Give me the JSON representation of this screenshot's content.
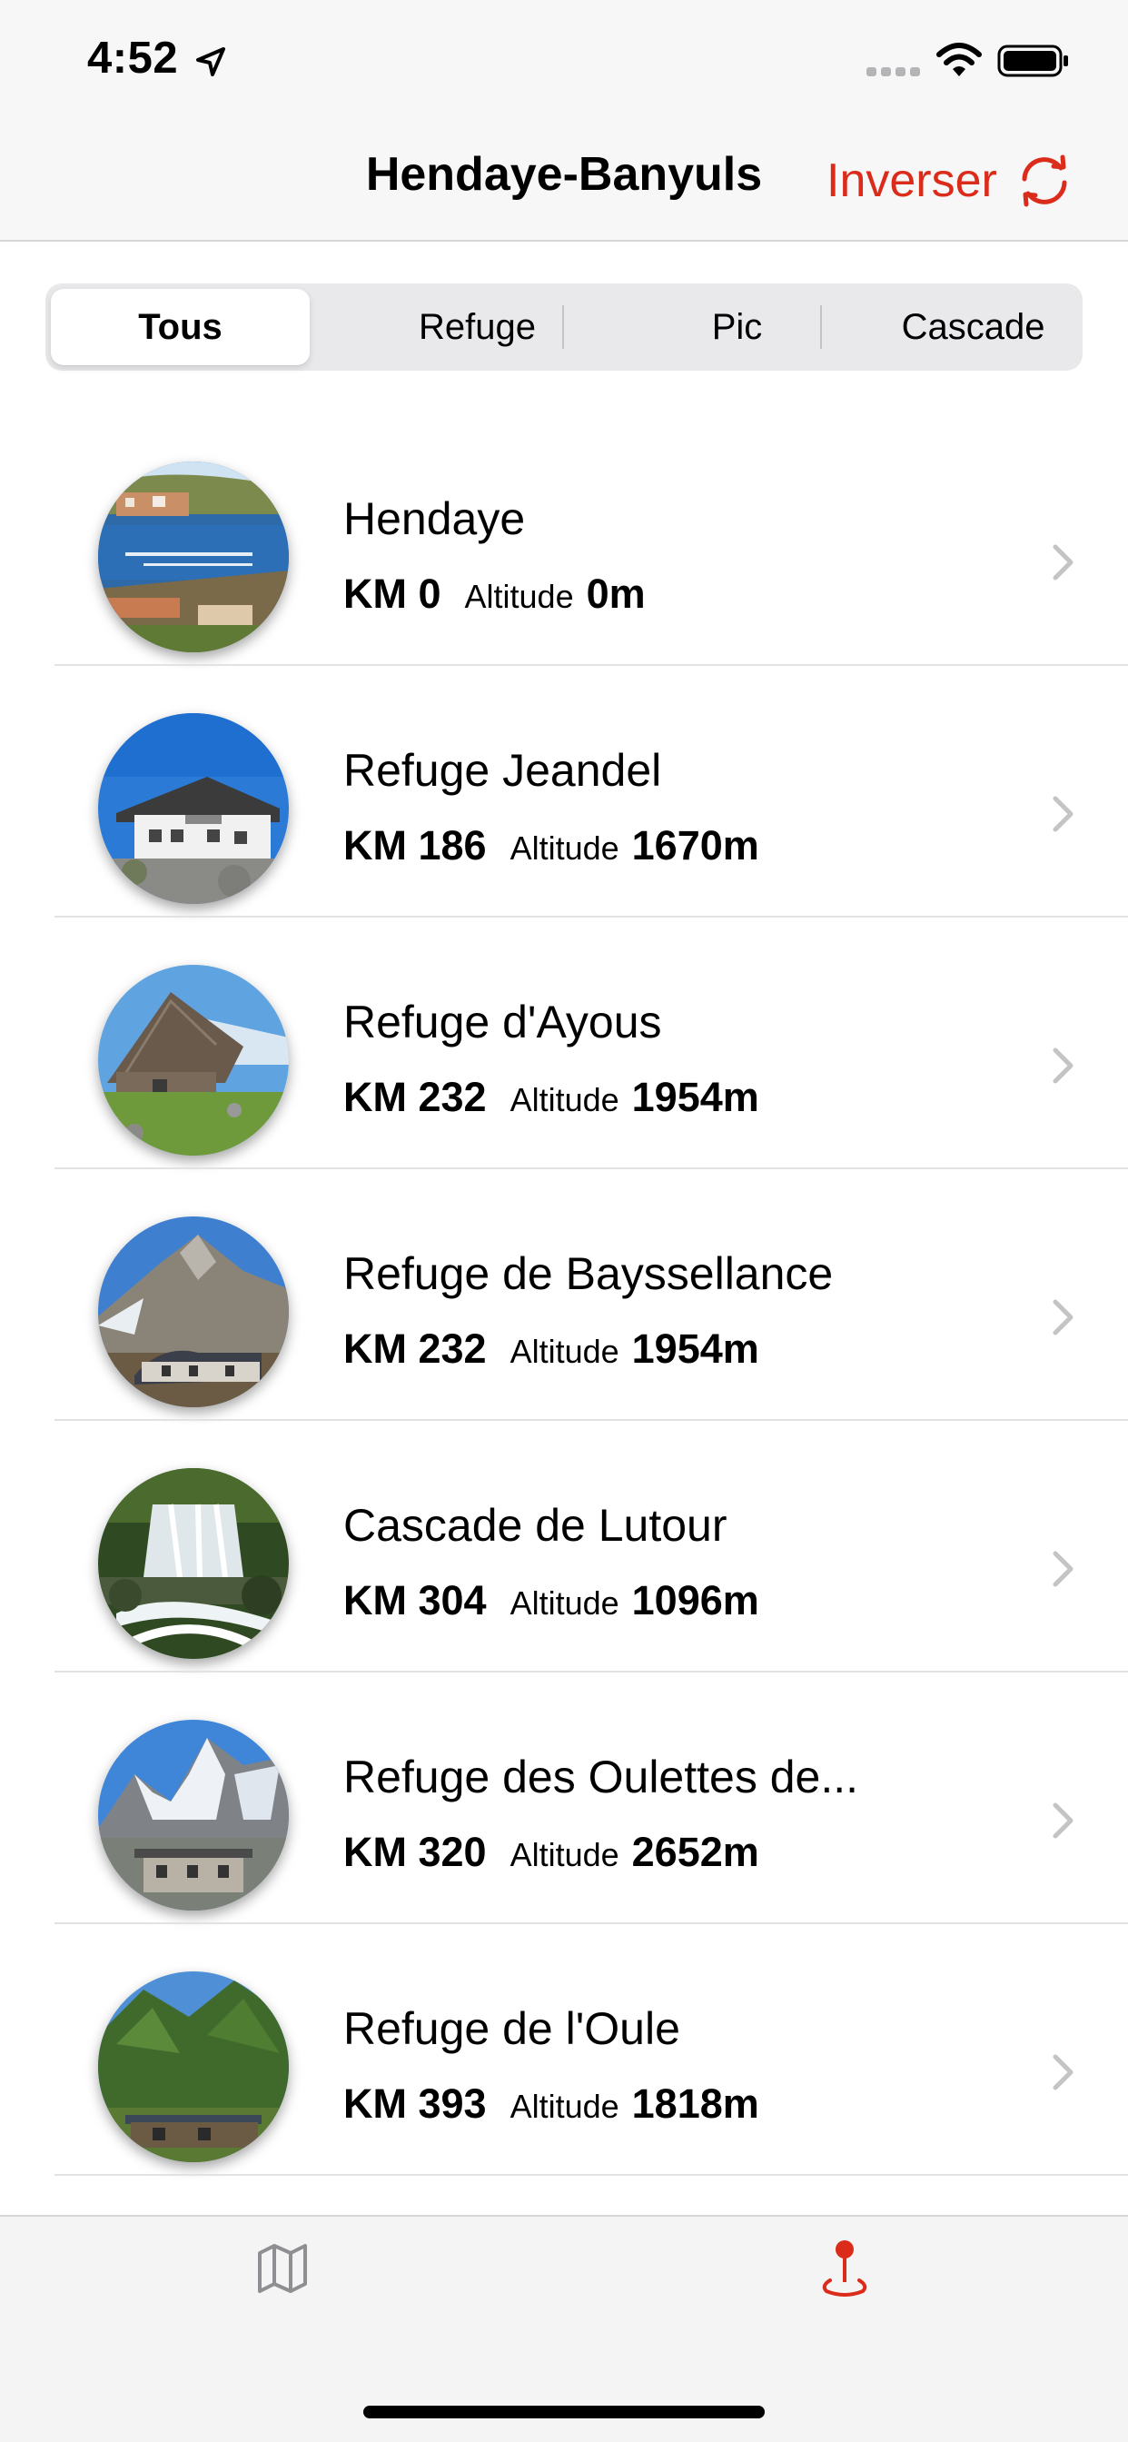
{
  "status_bar": {
    "time": "4:52"
  },
  "nav": {
    "title": "Hendaye-Banyuls",
    "action_label": "Inverser"
  },
  "segments": [
    {
      "label": "Tous",
      "selected": true
    },
    {
      "label": "Refuge",
      "selected": false
    },
    {
      "label": "Pic",
      "selected": false
    },
    {
      "label": "Cascade",
      "selected": false
    }
  ],
  "list": {
    "altitude_label": "Altitude",
    "items": [
      {
        "title": "Hendaye",
        "km": "KM 0",
        "altitude": "0m",
        "thumbnail": "harbor-town-photo"
      },
      {
        "title": "Refuge Jeandel",
        "km": "KM 186",
        "altitude": "1670m",
        "thumbnail": "mountain-hut-photo"
      },
      {
        "title": "Refuge d'Ayous",
        "km": "KM 232",
        "altitude": "1954m",
        "thumbnail": "stone-refuge-photo"
      },
      {
        "title": "Refuge de Bayssellance",
        "km": "KM 232",
        "altitude": "1954m",
        "thumbnail": "mountain-refuge-photo"
      },
      {
        "title": "Cascade de Lutour",
        "km": "KM 304",
        "altitude": "1096m",
        "thumbnail": "waterfall-photo"
      },
      {
        "title": "Refuge des Oulettes de...",
        "km": "KM 320",
        "altitude": "2652m",
        "thumbnail": "glacier-refuge-photo"
      },
      {
        "title": "Refuge de l'Oule",
        "km": "KM 393",
        "altitude": "1818m",
        "thumbnail": "green-valley-refuge-photo"
      }
    ]
  },
  "tab_bar": {
    "items": [
      {
        "icon": "map-icon",
        "selected": false
      },
      {
        "icon": "location-pin-icon",
        "selected": true
      }
    ]
  },
  "colors": {
    "accent": "#db2b1a",
    "separator": "#e2e2e4",
    "chevron": "#c4c4c7",
    "tab_inactive": "#8e8e93"
  }
}
